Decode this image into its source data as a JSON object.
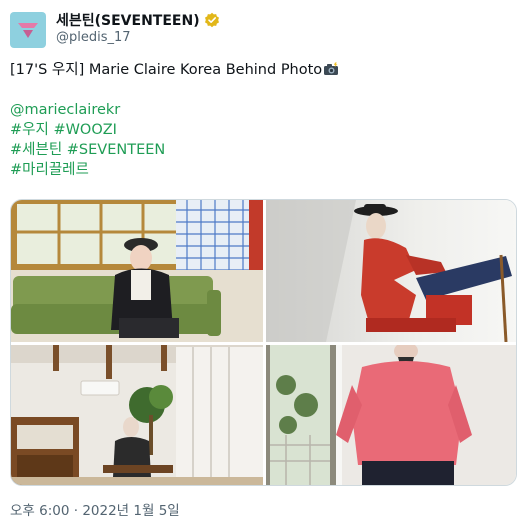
{
  "account": {
    "display_name": "세븐틴(SEVENTEEN)",
    "handle": "@pledis_17",
    "verified_icon": "verified-badge-gold",
    "avatar_icon": "seventeen-logo"
  },
  "tweet": {
    "title": "[17'S 우지] Marie Claire Korea Behind Photo",
    "title_emoji": "camera-flash-icon",
    "mention": "@marieclairekr",
    "hashtag_line_1": "#우지 #WOOZI",
    "hashtag_line_2": "#세븐틴 #SEVENTEEN",
    "hashtag_line_3": "#마리끌레르",
    "link_color": "#1f9d55"
  },
  "media": {
    "photo_count": 4,
    "photos": [
      {
        "name": "photo-green-sofa"
      },
      {
        "name": "photo-red-jacket-chair"
      },
      {
        "name": "photo-living-room"
      },
      {
        "name": "photo-pink-sweater"
      }
    ]
  },
  "timestamp": "오후 6:00 · 2022년 1월 5일"
}
